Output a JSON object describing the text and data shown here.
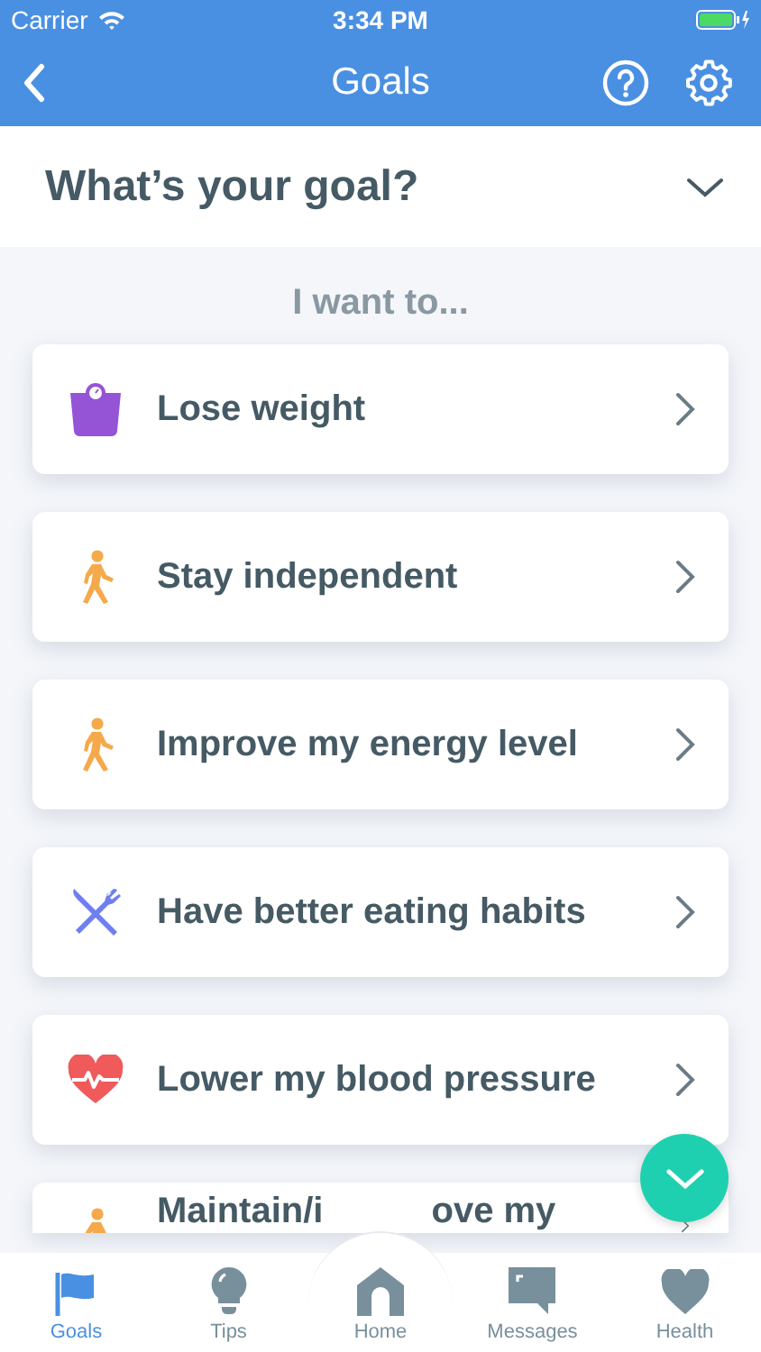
{
  "status_bar": {
    "carrier": "Carrier",
    "time": "3:34 PM"
  },
  "nav": {
    "title": "Goals"
  },
  "question": {
    "title": "What’s your goal?",
    "expanded": false
  },
  "prompt": "I want to...",
  "goals": [
    {
      "kind": "scale",
      "label": "Lose weight"
    },
    {
      "kind": "walker",
      "label": "Stay independent"
    },
    {
      "kind": "walker",
      "label": "Improve my energy level"
    },
    {
      "kind": "cutlery",
      "label": "Have better eating habits"
    },
    {
      "kind": "heart",
      "label": "Lower my blood pressure"
    },
    {
      "kind": "walker",
      "label": "Maintain/i",
      "label_rest": "ove my"
    }
  ],
  "tabs": [
    {
      "kind": "flag",
      "label": "Goals",
      "selected": true
    },
    {
      "kind": "bulb",
      "label": "Tips",
      "selected": false
    },
    {
      "kind": "home",
      "label": "Home",
      "selected": false
    },
    {
      "kind": "chat",
      "label": "Messages",
      "selected": false
    },
    {
      "kind": "heart",
      "label": "Health",
      "selected": false
    }
  ]
}
